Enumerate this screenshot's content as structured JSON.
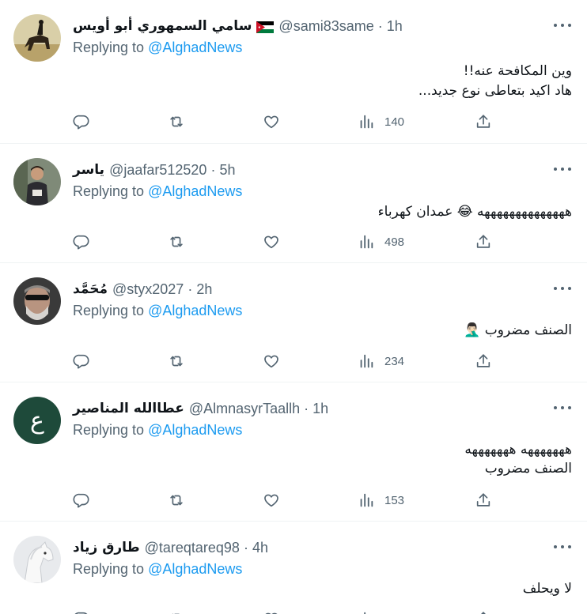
{
  "colors": {
    "text": "#0f1419",
    "muted": "#536471",
    "link": "#1d9bf0",
    "divider": "#eff3f4",
    "avatar_green": "#1e4a3a"
  },
  "icons": {
    "reply": "comment-bubble-icon",
    "retweet": "retweet-icon",
    "like": "heart-icon",
    "views": "bar-chart-icon",
    "share": "share-upload-icon",
    "more": "more-dots-icon"
  },
  "tweets": [
    {
      "name": "سامي السمهوري أبو أويس",
      "handle": "@sami83same",
      "dot": "·",
      "time": "1h",
      "replying_label": "Replying to",
      "replying_to": "@AlghadNews",
      "text_line1": "وين المكافحة عنه!!",
      "text_line2": "هاد اكيد بتعاطى نوع جديد...",
      "views": "140"
    },
    {
      "name": "ياسر",
      "handle": "@jaafar512520",
      "dot": "·",
      "time": "5h",
      "replying_label": "Replying to",
      "replying_to": "@AlghadNews",
      "text_line1": "ههههههههههههههه 😂 عمدان كهرباء",
      "views": "498"
    },
    {
      "name": "مُحَمَّد",
      "handle": "@styx2027",
      "dot": "·",
      "time": "2h",
      "replying_label": "Replying to",
      "replying_to": "@AlghadNews",
      "text_line1": "الصنف مضروب 🤦🏻‍♂️",
      "views": "234"
    },
    {
      "name": "عطاالله المناصير",
      "handle": "@AlmnasyrTaallh",
      "dot": "·",
      "time": "1h",
      "avatar_letter": "ع",
      "replying_label": "Replying to",
      "replying_to": "@AlghadNews",
      "text_line1": "هههههههه هههههههه",
      "text_line2": "الصنف مضروب",
      "views": "153"
    },
    {
      "name": "طارق زياد",
      "handle": "@tareqtareq98",
      "dot": "·",
      "time": "4h",
      "replying_label": "Replying to",
      "replying_to": "@AlghadNews",
      "text_line1": "لا ويحلف"
    }
  ]
}
